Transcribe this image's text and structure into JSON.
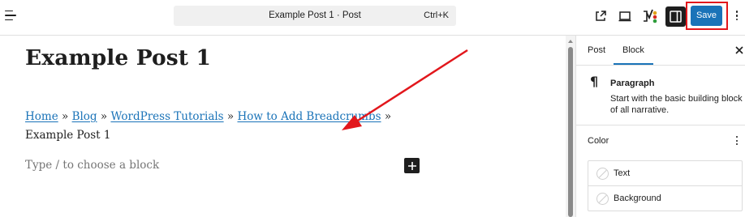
{
  "toolbar": {
    "command_title": "Example Post 1 · Post",
    "command_shortcut": "Ctrl+K",
    "save_label": "Save",
    "icons": [
      "document-overview-icon",
      "external-link-icon",
      "desktop-preview-icon",
      "yoast-seo-icon",
      "sidebar-settings-icon",
      "kebab-menu-icon"
    ]
  },
  "editor": {
    "post_title": "Example Post 1",
    "breadcrumbs": {
      "links": [
        "Home",
        "Blog",
        "WordPress Tutorials",
        "How to Add Breadcrumbs"
      ],
      "separator": "»",
      "current": "Example Post 1"
    },
    "block_placeholder": "Type / to choose a block"
  },
  "sidebar": {
    "tabs": [
      "Post",
      "Block"
    ],
    "active_tab": "Block",
    "block": {
      "name": "Paragraph",
      "description": "Start with the basic building block of all narrative."
    },
    "color_panel": {
      "title": "Color",
      "items": [
        "Text",
        "Background"
      ]
    }
  },
  "colors": {
    "accent": "#1a73b8",
    "annotation": "#e2171c",
    "text": "#1e1e1e",
    "border": "#e0e0e0"
  }
}
